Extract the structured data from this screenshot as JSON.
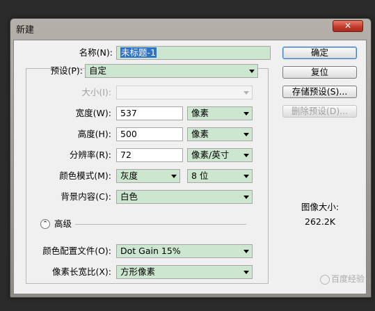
{
  "window": {
    "title": "新建"
  },
  "form": {
    "name": {
      "label": "名称(N):",
      "value": "未标题-1"
    },
    "preset": {
      "label": "预设(P):",
      "value": "自定"
    },
    "size": {
      "label": "大小(I):",
      "value": ""
    },
    "width": {
      "label": "宽度(W):",
      "value": "537",
      "unit": "像素"
    },
    "height": {
      "label": "高度(H):",
      "value": "500",
      "unit": "像素"
    },
    "resolution": {
      "label": "分辨率(R):",
      "value": "72",
      "unit": "像素/英寸"
    },
    "color_mode": {
      "label": "颜色模式(M):",
      "value": "灰度",
      "depth": "8 位"
    },
    "background": {
      "label": "背景内容(C):",
      "value": "白色"
    },
    "advanced": {
      "label": "高级",
      "expander_glyph": "⌃"
    },
    "color_profile": {
      "label": "颜色配置文件(O):",
      "value": "Dot Gain 15%"
    },
    "pixel_aspect": {
      "label": "像素长宽比(X):",
      "value": "方形像素"
    }
  },
  "buttons": {
    "ok": "确定",
    "reset": "复位",
    "save_preset": "存储预设(S)...",
    "delete_preset": "删除预设(D)..."
  },
  "image_size": {
    "label": "图像大小:",
    "value": "262.2K"
  },
  "watermark": "百度经验"
}
